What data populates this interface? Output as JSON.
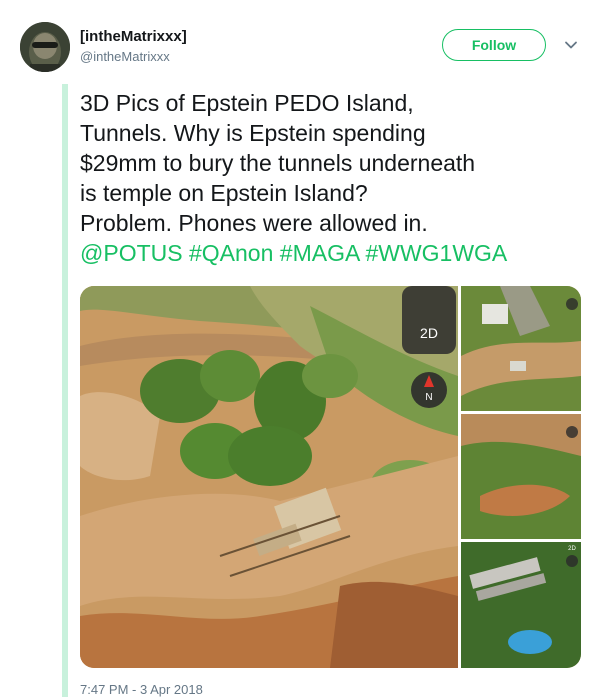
{
  "user": {
    "display_name": "[intheMatrixxx]",
    "handle": "@intheMatrixxx"
  },
  "follow_label": "Follow",
  "tweet": {
    "lines": [
      "3D Pics of Epstein PEDO Island,",
      "Tunnels. Why is Epstein spending",
      "$29mm to bury the tunnels underneath",
      "is temple on Epstein Island?",
      "Problem. Phones were allowed in."
    ],
    "hashtags": [
      "@POTUS",
      "#QAnon",
      "#MAGA",
      "#WWG1WGA"
    ]
  },
  "media": {
    "map_mode_label": "2D",
    "compass_label": "N",
    "thumbnail_corner_label": "2D"
  },
  "timestamp": "7:47 PM - 3 Apr 2018",
  "colors": {
    "accent": "#17bf63",
    "thread_line": "#c8f1dc",
    "secondary_text": "#657786"
  }
}
